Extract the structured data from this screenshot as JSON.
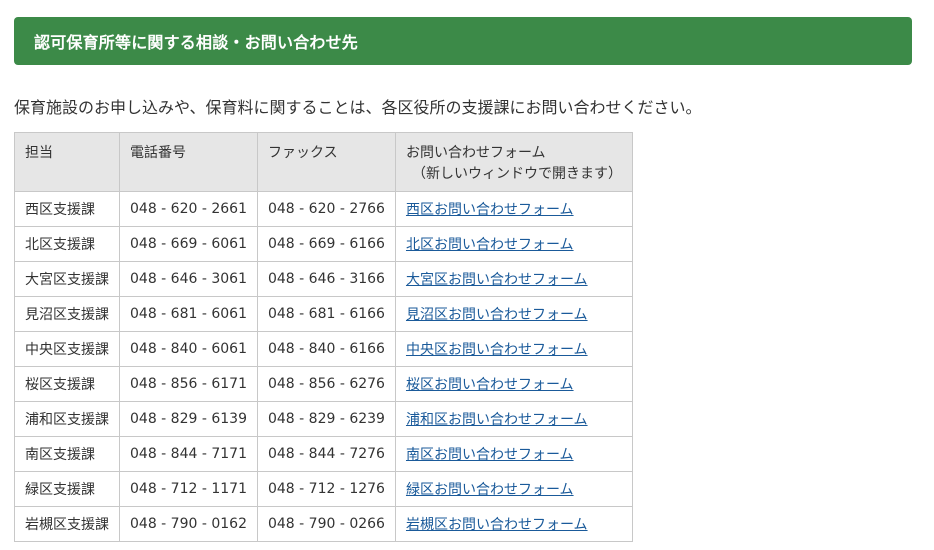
{
  "header": {
    "title": "認可保育所等に関する相談・お問い合わせ先"
  },
  "intro_text": "保育施設のお申し込みや、保育料に関することは、各区役所の支援課にお問い合わせください。",
  "colors": {
    "header_bg": "#3c8a48",
    "link": "#1a5a9a",
    "table_header_bg": "#e6e6e6"
  },
  "table": {
    "headers": {
      "office": "担当",
      "phone": "電話番号",
      "fax": "ファックス",
      "form": "お問い合わせフォーム",
      "form_note": "（新しいウィンドウで開きます）"
    },
    "rows": [
      {
        "office": "西区支援課",
        "phone": "048 - 620 - 2661",
        "fax": "048 - 620 - 2766",
        "form": "西区お問い合わせフォーム"
      },
      {
        "office": "北区支援課",
        "phone": "048 - 669 - 6061",
        "fax": "048 - 669 - 6166",
        "form": "北区お問い合わせフォーム"
      },
      {
        "office": "大宮区支援課",
        "phone": "048 - 646 - 3061",
        "fax": "048 - 646 - 3166",
        "form": "大宮区お問い合わせフォーム"
      },
      {
        "office": "見沼区支援課",
        "phone": "048 - 681 - 6061",
        "fax": "048 - 681 - 6166",
        "form": "見沼区お問い合わせフォーム"
      },
      {
        "office": "中央区支援課",
        "phone": "048 - 840 - 6061",
        "fax": "048 - 840 - 6166",
        "form": "中央区お問い合わせフォーム"
      },
      {
        "office": "桜区支援課",
        "phone": "048 - 856 - 6171",
        "fax": "048 - 856 - 6276",
        "form": "桜区お問い合わせフォーム"
      },
      {
        "office": "浦和区支援課",
        "phone": "048 - 829 - 6139",
        "fax": "048 - 829 - 6239",
        "form": "浦和区お問い合わせフォーム"
      },
      {
        "office": "南区支援課",
        "phone": "048 - 844 - 7171",
        "fax": "048 - 844 - 7276",
        "form": "南区お問い合わせフォーム"
      },
      {
        "office": "緑区支援課",
        "phone": "048 - 712 - 1171",
        "fax": "048 - 712 - 1276",
        "form": "緑区お問い合わせフォーム"
      },
      {
        "office": "岩槻区支援課",
        "phone": "048 - 790 - 0162",
        "fax": "048 - 790 - 0266",
        "form": "岩槻区お問い合わせフォーム"
      }
    ]
  }
}
